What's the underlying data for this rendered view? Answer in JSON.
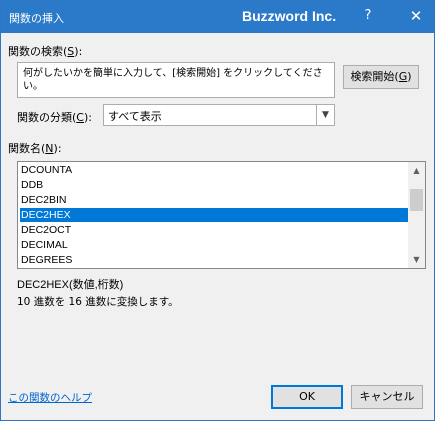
{
  "window": {
    "title_left": "関数の挿入",
    "title_center": "Buzzword Inc.",
    "help_glyph": "?",
    "close_glyph": "✕"
  },
  "search": {
    "label_prefix": "関数の検索(",
    "label_key": "S",
    "label_suffix": "):",
    "value": "何がしたいかを簡単に入力して、[検索開始] をクリックしてください。",
    "button_prefix": "検索開始(",
    "button_key": "G",
    "button_suffix": ")"
  },
  "category": {
    "label_prefix": "関数の分類(",
    "label_key": "C",
    "label_suffix": "):",
    "selected": "すべて表示"
  },
  "functions": {
    "label_prefix": "関数名(",
    "label_key": "N",
    "label_suffix": "):",
    "items": [
      "DCOUNTA",
      "DDB",
      "DEC2BIN",
      "DEC2HEX",
      "DEC2OCT",
      "DECIMAL",
      "DEGREES"
    ],
    "selected_index": 3
  },
  "description": {
    "syntax": "DEC2HEX(数値,桁数)",
    "text": "10 進数を 16 進数に変換します。"
  },
  "footer": {
    "help_link": "この関数のヘルプ",
    "ok_label": "OK",
    "cancel_label": "キャンセル"
  },
  "colors": {
    "titlebar": "#2b79c9",
    "selection": "#0078d7",
    "link": "#0066cc"
  },
  "icons": {
    "select_arrow": "chevron-down-icon",
    "scroll_up": "triangle-up-icon",
    "scroll_down": "triangle-down-icon"
  }
}
